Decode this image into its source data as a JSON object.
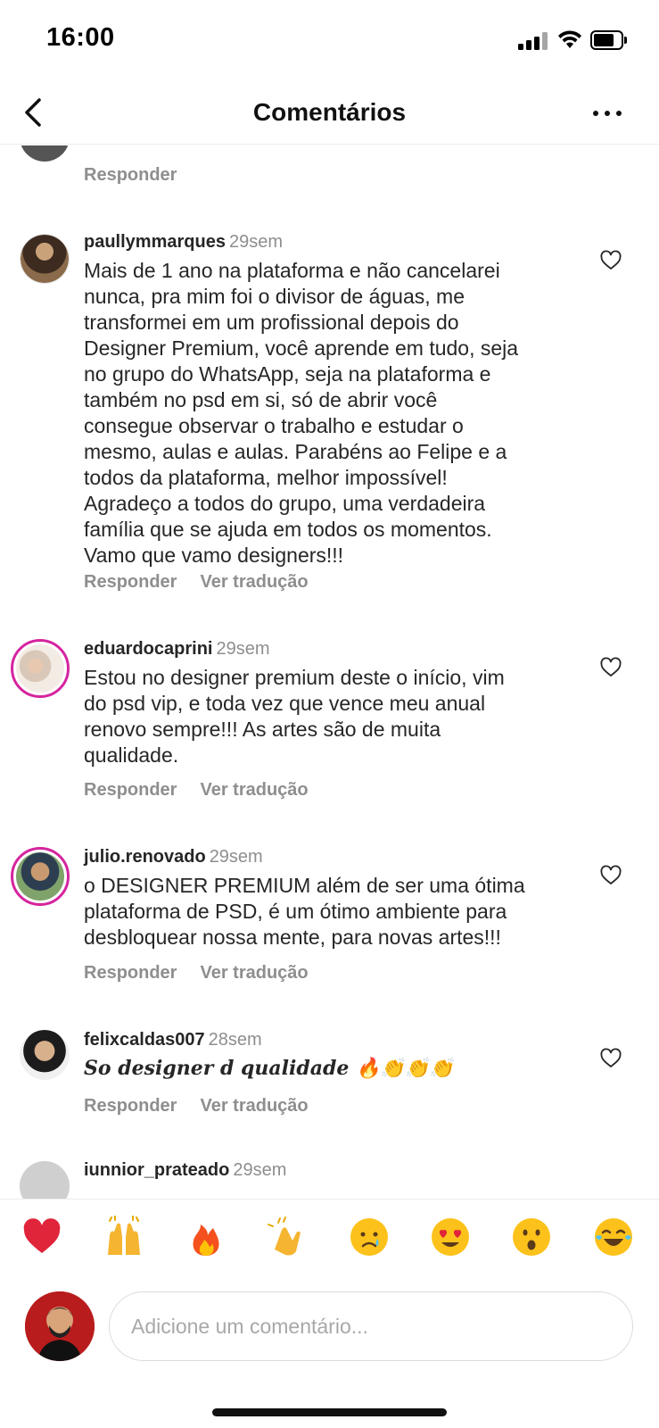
{
  "status_bar": {
    "time": "16:00"
  },
  "nav": {
    "title": "Comentários"
  },
  "comments": [
    {
      "user": "",
      "time": "",
      "text": "",
      "actions": [
        "Responder"
      ]
    },
    {
      "user": "paullymmarques",
      "time": "29sem",
      "text": "Mais de 1 ano na plataforma e não cancelarei\nnunca, pra mim foi o divisor de águas, me\ntransformei em um profissional depois do\nDesigner Premium, você aprende em tudo, seja\nno grupo do WhatsApp, seja na plataforma e\ntambém no psd em si, só de abrir você\nconsegue observar o trabalho e estudar o\nmesmo, aulas e aulas. Parabéns ao Felipe e a\ntodos da plataforma, melhor impossível!\nAgradeço a todos do grupo, uma verdadeira\nfamília que se ajuda em todos os momentos.\nVamo que vamo designers!!!",
      "actions": [
        "Responder",
        "Ver tradução"
      ]
    },
    {
      "user": "eduardocaprini",
      "time": "29sem",
      "text": "Estou no designer premium deste o início, vim\ndo psd vip, e toda vez que vence meu anual\nrenovo sempre!!! As artes são de muita\nqualidade.",
      "actions": [
        "Responder",
        "Ver tradução"
      ]
    },
    {
      "user": "julio.renovado",
      "time": "29sem",
      "text": "o DESIGNER PREMIUM além de ser uma ótima\nplataforma de PSD, é um ótimo ambiente para\ndesbloquear nossa mente, para novas artes!!!",
      "actions": [
        "Responder",
        "Ver tradução"
      ]
    },
    {
      "user": "felixcaldas007",
      "time": "28sem",
      "text": "So designer d  qualidade 🔥👏👏👏",
      "actions": [
        "Responder",
        "Ver tradução"
      ]
    },
    {
      "user": "iunnior_prateado",
      "time": "29sem",
      "text": "",
      "actions": []
    }
  ],
  "reactions": [
    "heart",
    "raised-hands",
    "fire",
    "clap",
    "crying-face",
    "heart-eyes",
    "surprised-face",
    "tears-of-joy"
  ],
  "composer": {
    "placeholder": "Adicione um comentário..."
  },
  "colors": {
    "text": "#262626",
    "muted": "#8e8e8e",
    "story_ring": "#d6249f",
    "input_border": "#dbdbdb"
  }
}
